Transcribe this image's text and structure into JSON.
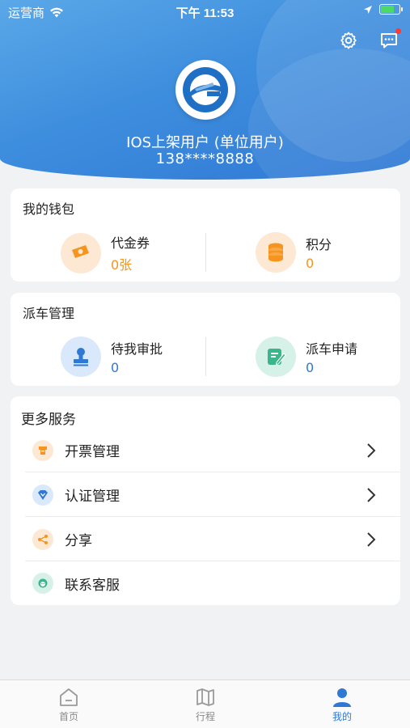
{
  "status_bar": {
    "carrier": "运营商",
    "time": "下午 11:53"
  },
  "header": {
    "user_name": "IOS上架用户 (单位用户)",
    "phone": "138****8888"
  },
  "wallet": {
    "title": "我的钱包",
    "items": [
      {
        "label": "代金券",
        "value": "0张",
        "icon": "voucher-icon"
      },
      {
        "label": "积分",
        "value": "0",
        "icon": "coins-icon"
      }
    ]
  },
  "dispatch": {
    "title": "派车管理",
    "items": [
      {
        "label": "待我审批",
        "value": "0",
        "icon": "approval-stamp-icon"
      },
      {
        "label": "派车申请",
        "value": "0",
        "icon": "application-form-icon"
      }
    ]
  },
  "services": {
    "title": "更多服务",
    "items": [
      {
        "label": "开票管理",
        "icon": "invoice-icon"
      },
      {
        "label": "认证管理",
        "icon": "certification-icon"
      },
      {
        "label": "分享",
        "icon": "share-icon"
      },
      {
        "label": "联系客服",
        "icon": "customer-service-icon"
      }
    ]
  },
  "tabs": [
    {
      "label": "首页",
      "icon": "home-icon"
    },
    {
      "label": "行程",
      "icon": "map-icon"
    },
    {
      "label": "我的",
      "icon": "profile-icon"
    }
  ],
  "colors": {
    "accent": "#2f78d4",
    "orange": "#f5941e",
    "value_blue": "#2f78d4"
  }
}
